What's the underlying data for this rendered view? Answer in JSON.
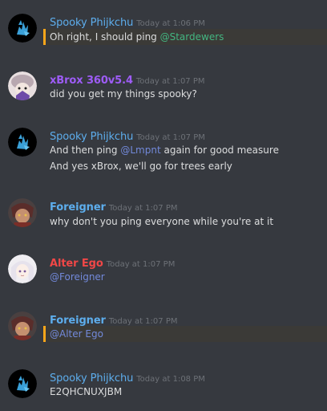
{
  "colors": {
    "background": "#36393f",
    "text": "#dcddde",
    "timestamp": "#6d7177",
    "mention_bar": "#faa61a",
    "spooky": "#5dadec",
    "xbrox": "#9e5cf7",
    "foreigner": "#5dadec",
    "alter_ego": "#f04747",
    "mention_green": "#43b581",
    "mention_blue": "#7289da"
  },
  "messages": [
    {
      "author": "Spooky Phijkchu",
      "timestamp": "Today at 1:06 PM",
      "avatar_icon": "spooky-avatar-icon",
      "lines": [
        {
          "text": "Oh right, I should ping ",
          "mention": "@Stardewers"
        }
      ]
    },
    {
      "author": "xBrox 360v5.4",
      "timestamp": "Today at 1:07 PM",
      "avatar_icon": "xbrox-avatar-icon",
      "lines": [
        {
          "text": "did you get my things spooky?"
        }
      ]
    },
    {
      "author": "Spooky Phijkchu",
      "timestamp": "Today at 1:07 PM",
      "avatar_icon": "spooky-avatar-icon",
      "lines": [
        {
          "pre": "And then ping ",
          "mention": "@Lmpnt",
          "post": " again for good measure"
        },
        {
          "text": "And yes xBrox, we'll go for trees early"
        }
      ]
    },
    {
      "author": "Foreigner",
      "timestamp": "Today at 1:07 PM",
      "avatar_icon": "foreigner-avatar-icon",
      "lines": [
        {
          "text": "why don't you ping everyone while you're at it"
        }
      ]
    },
    {
      "author": "Alter Ego",
      "timestamp": "Today at 1:07 PM",
      "avatar_icon": "alter-ego-avatar-icon",
      "lines": [
        {
          "mention": "@Foreigner"
        }
      ]
    },
    {
      "author": "Foreigner",
      "timestamp": "Today at 1:07 PM",
      "avatar_icon": "foreigner-avatar-icon",
      "lines": [
        {
          "mention": "@Alter Ego"
        }
      ]
    },
    {
      "author": "Spooky Phijkchu",
      "timestamp": "Today at 1:08 PM",
      "avatar_icon": "spooky-avatar-icon",
      "lines": [
        {
          "text": "E2QHCNUXJBM"
        }
      ]
    }
  ]
}
